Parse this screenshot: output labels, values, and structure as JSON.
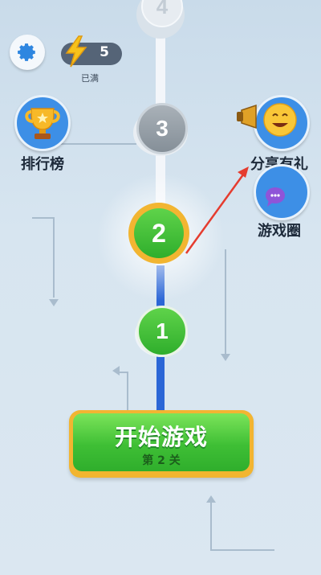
{
  "energy": {
    "count": "5",
    "status": "已满"
  },
  "side_buttons": {
    "leaderboard_label": "排行榜",
    "share_label": "分享有礼",
    "community_label": "游戏圈"
  },
  "levels": [
    {
      "number": "4",
      "state": "locked"
    },
    {
      "number": "3",
      "state": "locked"
    },
    {
      "number": "2",
      "state": "current"
    },
    {
      "number": "1",
      "state": "completed"
    }
  ],
  "start_button": {
    "title": "开始游戏",
    "subtitle": "第 2 关"
  },
  "colors": {
    "accent_blue": "#3d8fe6",
    "path_blue": "#2b66d6",
    "green": "#3fbf35",
    "gold": "#f2b531",
    "locked_gray": "#8d979f",
    "hint_arrow": "#e53c2f"
  },
  "icons": [
    "gear-icon",
    "lightning-icon",
    "trophy-icon",
    "megaphone-emoji-icon",
    "ghost-mascot-icon",
    "chat-bubble-icon"
  ]
}
